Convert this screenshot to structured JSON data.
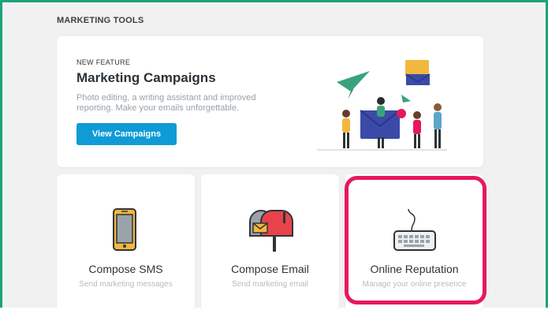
{
  "section": {
    "title": "MARKETING TOOLS"
  },
  "feature": {
    "eyebrow": "NEW FEATURE",
    "title": "Marketing Campaigns",
    "description": "Photo editing, a writing assistant and improved reporting. Make your emails unforgettable.",
    "button_label": "View Campaigns",
    "illustration": "marketing-campaigns-illustration"
  },
  "tiles": [
    {
      "title": "Compose SMS",
      "subtitle": "Send marketing messages",
      "icon": "mobile-phone-icon"
    },
    {
      "title": "Compose Email",
      "subtitle": "Send marketing email",
      "icon": "mailbox-icon"
    },
    {
      "title": "Online Reputation",
      "subtitle": "Manage your online presence",
      "icon": "keyboard-icon",
      "highlighted": true
    }
  ],
  "colors": {
    "frame_border": "#1aa37a",
    "primary_button": "#0f9bd6",
    "highlight": "#e8185c",
    "background": "#f1f1f1"
  }
}
